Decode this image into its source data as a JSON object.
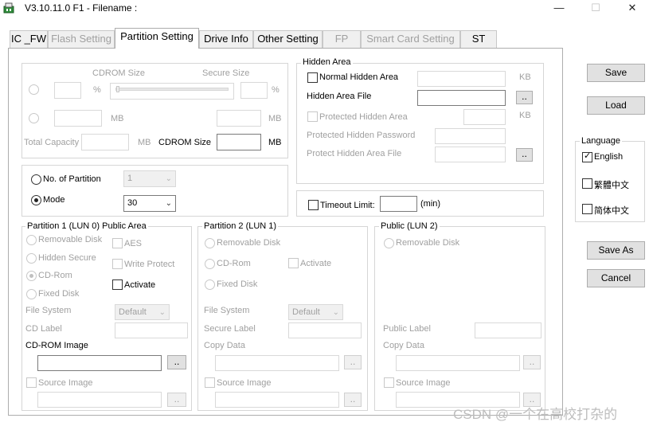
{
  "window": {
    "title": "V3.10.11.0 F1 - Filename :",
    "controls": {
      "minimize": "—",
      "maximize": "☐",
      "close": "✕"
    }
  },
  "tabs": [
    {
      "label": "IC _FW",
      "enabled": true
    },
    {
      "label": "Flash Setting",
      "enabled": false
    },
    {
      "label": "Partition Setting",
      "enabled": true,
      "active": true
    },
    {
      "label": "Drive Info",
      "enabled": true
    },
    {
      "label": "Other Setting",
      "enabled": true
    },
    {
      "label": "FP",
      "enabled": false
    },
    {
      "label": "Smart Card Setting",
      "enabled": false
    },
    {
      "label": "ST",
      "enabled": true
    }
  ],
  "cdrom": {
    "cdrom_size_label": "CDROM Size",
    "secure_size_label": "Secure Size",
    "percent_unit": "%",
    "mb_unit": "MB",
    "total_capacity_label": "Total Capacity",
    "cdrom_size_label_active": "CDROM Size"
  },
  "partition_mode": {
    "no_of_partition_label": "No. of Partition",
    "no_of_partition_value": "1",
    "mode_label": "Mode",
    "mode_value": "30",
    "mode_selected": true
  },
  "hidden_area": {
    "title": "Hidden Area",
    "normal_hidden_area_label": "Normal Hidden Area",
    "kb_unit": "KB",
    "hidden_area_file_label": "Hidden Area File",
    "browse_label": "..",
    "protected_hidden_area_label": "Protected Hidden Area",
    "protected_hidden_password_label": "Protected Hidden Password",
    "protect_hidden_area_file_label": "Protect Hidden Area File"
  },
  "timeout": {
    "label": "Timeout Limit:",
    "unit": "(min)"
  },
  "partition1": {
    "title": "Partition 1 (LUN 0) Public Area",
    "removable_disk": "Removable Disk",
    "hidden_secure": "Hidden Secure",
    "cd_rom": "CD-Rom",
    "fixed_disk": "Fixed Disk",
    "aes": "AES",
    "write_protect": "Write Protect",
    "activate": "Activate",
    "file_system_label": "File System",
    "file_system_value": "Default",
    "cd_label": "CD Label",
    "cd_rom_image": "CD-ROM Image",
    "browse_label": "..",
    "source_image": "Source Image"
  },
  "partition2": {
    "title": "Partition 2 (LUN 1)",
    "removable_disk": "Removable Disk",
    "cd_rom": "CD-Rom",
    "fixed_disk": "Fixed Disk",
    "activate": "Activate",
    "file_system_label": "File System",
    "file_system_value": "Default",
    "secure_label": "Secure Label",
    "copy_data": "Copy Data",
    "browse_label": "..",
    "source_image": "Source Image"
  },
  "public_lun2": {
    "title": "Public (LUN 2)",
    "removable_disk": "Removable Disk",
    "public_label": "Public Label",
    "copy_data": "Copy Data",
    "browse_label": "..",
    "source_image": "Source Image"
  },
  "sidebar": {
    "save": "Save",
    "load": "Load",
    "language_title": "Language",
    "languages": [
      {
        "label": "English",
        "checked": true
      },
      {
        "label": "繁體中文",
        "checked": false
      },
      {
        "label": "简体中文",
        "checked": false
      }
    ],
    "save_as": "Save As",
    "cancel": "Cancel"
  },
  "watermark": "CSDN @一个在高校打杂的",
  "colors": {
    "background": "#ffffff",
    "disabled_text": "#a0a0a0",
    "border": "#adadad"
  }
}
